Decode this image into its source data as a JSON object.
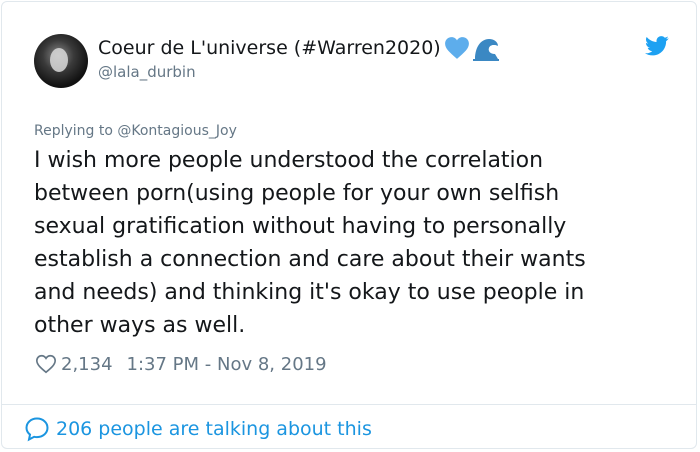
{
  "author": {
    "display_name": "Coeur de L'universe (#Warren2020)",
    "handle": "@lala_durbin",
    "emojis": [
      "blue-heart",
      "water-wave"
    ]
  },
  "reply": {
    "label": "Replying to @Kontagious_Joy"
  },
  "tweet": {
    "lines": [
      "I wish more people understood the correlation",
      "between porn(using people for your own selfish",
      "sexual gratification without having to personally",
      "establish a connection and care about their wants",
      "and needs) and thinking it's okay to use people in",
      "other ways as well."
    ]
  },
  "meta": {
    "likes": "2,134",
    "timestamp": "1:37 PM - Nov 8, 2019"
  },
  "footer": {
    "talking_label": "206 people are talking about this"
  },
  "colors": {
    "twitter_blue": "#1da1f2",
    "link_blue": "#1b95e0",
    "secondary_text": "#657786",
    "primary_text": "#14171a"
  }
}
